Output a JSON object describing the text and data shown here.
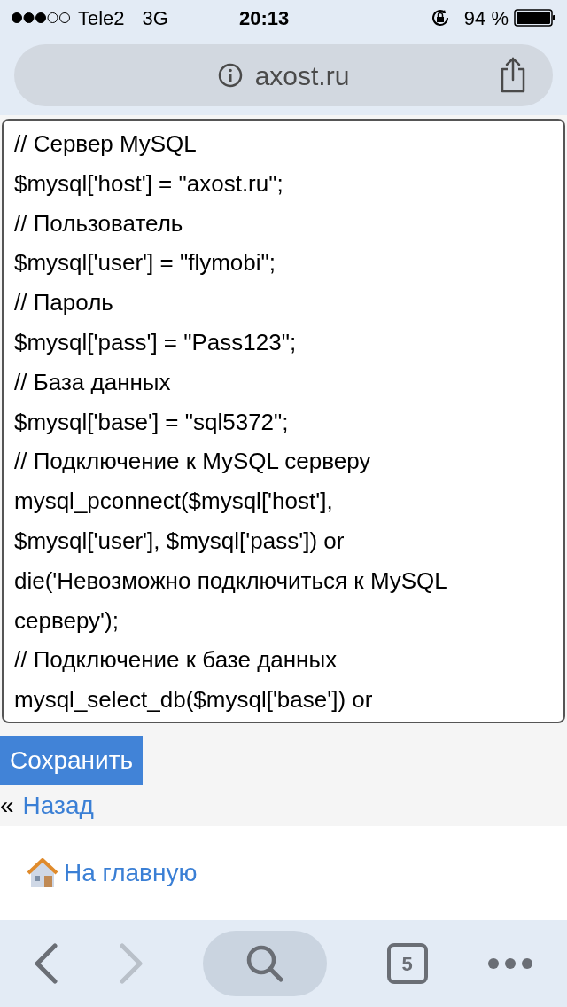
{
  "status_bar": {
    "carrier": "Tele2",
    "network": "3G",
    "time": "20:13",
    "battery": "94 %"
  },
  "address_bar": {
    "url": "axost.ru"
  },
  "editor": {
    "lines": [
      "// Сервер MySQL",
      "$mysql['host'] = \"axost.ru\";",
      "// Пользователь",
      "$mysql['user'] = \"flymobi\";",
      "// Пароль",
      "$mysql['pass'] = \"Pass123\";",
      "// База данных",
      "$mysql['base'] = \"sql5372\";",
      "// Подключение к MySQL серверу",
      "mysql_pconnect($mysql['host'],",
      "$mysql['user'], $mysql['pass']) or",
      "die('Невозможно подключиться к MySQL",
      "серверу');",
      "// Подключение к базе данных",
      "mysql_select_db($mysql['base']) or"
    ]
  },
  "save_button": "Сохранить",
  "back": {
    "mark": "«",
    "link": "Назад"
  },
  "home_link": "На главную",
  "toolbar": {
    "tabs_count": "5"
  }
}
